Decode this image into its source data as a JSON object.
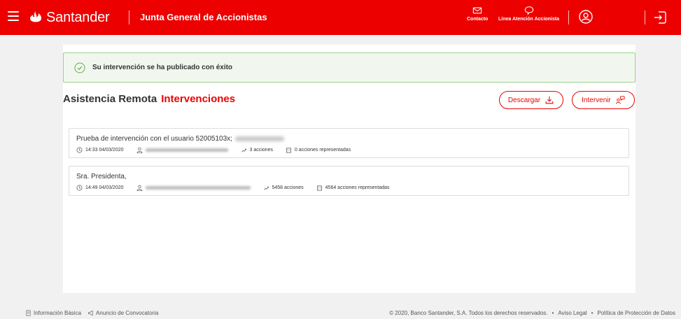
{
  "header": {
    "brand": "Santander",
    "app_title": "Junta General de Accionistas",
    "contact_label": "Contacto",
    "line_label": "Línea Atención Accionista",
    "color": "#ec0000"
  },
  "alert": {
    "message": "Su intervención se ha publicado con éxito"
  },
  "page": {
    "title": "Asistencia Remota",
    "subtitle": "Intervenciones",
    "download_label": "Descargar",
    "intervene_label": "Intervenir"
  },
  "interventions": [
    {
      "title": "Prueba de intervención con el usuario 52005103x;",
      "time": "14:33 04/03/2020",
      "shares": "3  acciones",
      "represented": "0  acciones representadas"
    },
    {
      "title": "Sra. Presidenta,",
      "time": "14:49 04/03/2020",
      "shares": "5458  acciones",
      "represented": "4564  acciones representadas"
    }
  ],
  "footer": {
    "basic_info": "Información Básica",
    "notice": "Anuncio de Convocatoria",
    "copyright": "© 2020, Banco Santander, S.A. Todos los derechos reservados.",
    "legal": "Aviso Legal",
    "privacy": "Política de Protección de Datos",
    "separator": "•"
  },
  "icons": {
    "menu": "hamburger-icon",
    "logo": "santander-flame-logo",
    "contact": "envelope-icon",
    "line": "speech-bubble-icon",
    "user": "user-circle-icon",
    "logout": "logout-icon",
    "success": "check-circle-icon",
    "download": "download-icon",
    "intervene": "chat-person-icon",
    "time": "clock-icon",
    "person": "person-icon",
    "shares": "shares-icon",
    "represented": "building-icon"
  }
}
